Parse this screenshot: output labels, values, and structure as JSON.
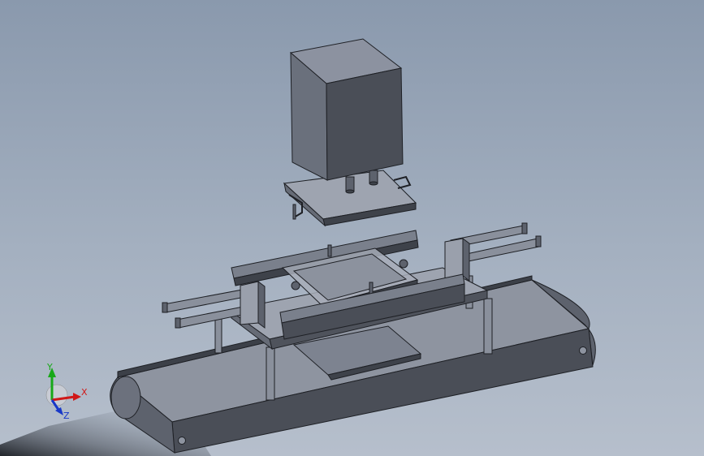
{
  "viewport": {
    "background_top": "#8a99ad",
    "background_bottom": "#b6bfcc"
  },
  "colors": {
    "body_dark": "#4a4e57",
    "body_mid": "#6f7582",
    "body_light": "#9aa0ac",
    "edge": "#1e2025",
    "x_axis": "#d01818",
    "y_axis": "#18a818",
    "z_axis": "#1838c8"
  },
  "triad": {
    "x_label": "X",
    "y_label": "Y",
    "z_label": "Z",
    "icon": "coordinate-triad-icon"
  }
}
